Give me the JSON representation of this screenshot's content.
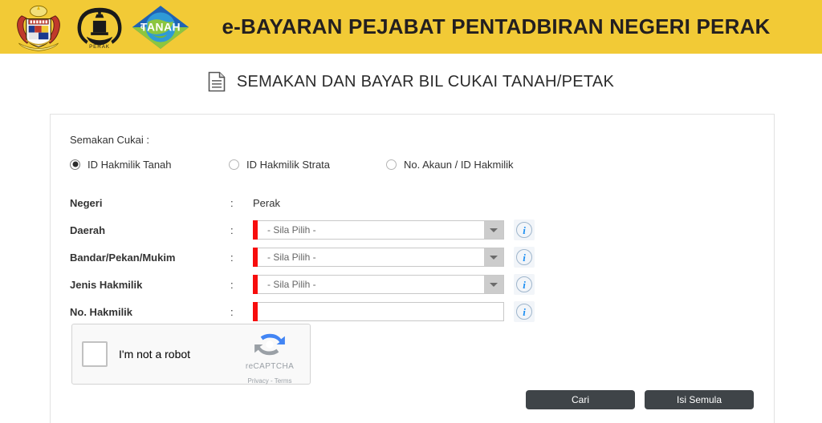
{
  "header": {
    "title": "e-BAYARAN PEJABAT PENTADBIRAN NEGERI PERAK",
    "logos": [
      {
        "name": "malaysia-coat-of-arms-logo",
        "alt": "Jata Negara Malaysia"
      },
      {
        "name": "perak-state-emblem-logo",
        "alt": "PERAK"
      },
      {
        "name": "etanah-logo",
        "alt": "eTANAH"
      }
    ],
    "etanah_text": "eTANAH",
    "perak_text": "PERAK",
    "bg_color": "#f2ca36"
  },
  "page": {
    "icon": "document-icon",
    "title": "SEMAKAN DAN BAYAR BIL CUKAI TANAH/PETAK"
  },
  "form": {
    "group_label": "Semakan Cukai :",
    "radios": [
      {
        "label": "ID Hakmilik Tanah",
        "checked": true
      },
      {
        "label": "ID Hakmilik Strata",
        "checked": false
      },
      {
        "label": "No. Akaun / ID Hakmilik",
        "checked": false
      }
    ],
    "colon": ":",
    "rows": [
      {
        "label": "Negeri",
        "type": "static",
        "value": "Perak"
      },
      {
        "label": "Daerah",
        "type": "select",
        "value": "- Sila Pilih -",
        "required": true,
        "info": true
      },
      {
        "label": "Bandar/Pekan/Mukim",
        "type": "select",
        "value": "- Sila Pilih -",
        "required": true,
        "info": true
      },
      {
        "label": "Jenis Hakmilik",
        "type": "select",
        "value": "- Sila Pilih -",
        "required": true,
        "info": true
      },
      {
        "label": "No. Hakmilik",
        "type": "text",
        "value": "",
        "required": true,
        "info": true
      }
    ],
    "info_glyph": "i",
    "required_color": "#f70d0d"
  },
  "recaptcha": {
    "label": "I'm not a robot",
    "brand": "reCAPTCHA",
    "privacy": "Privacy",
    "separator": " - ",
    "terms": "Terms",
    "checked": false
  },
  "buttons": {
    "search": "Cari",
    "reset": "Isi Semula",
    "color": "#3f4448"
  }
}
